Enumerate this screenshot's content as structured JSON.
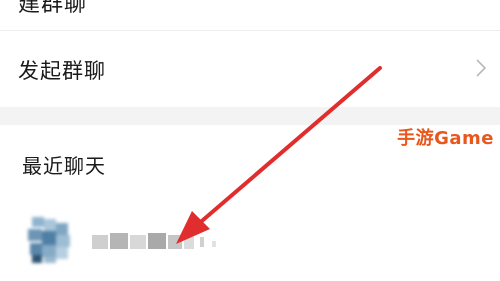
{
  "partial_top_row": {
    "label": "建群聊"
  },
  "group_chat_row": {
    "label": "发起群聊",
    "chevron": "chevron-right-icon"
  },
  "recent": {
    "title": "最近聊天"
  },
  "watermark": {
    "text": "手游Game"
  },
  "colors": {
    "accent": "#e8571c",
    "arrow": "#e02d2d",
    "background": "#ffffff",
    "gap": "#f3f3f3"
  }
}
